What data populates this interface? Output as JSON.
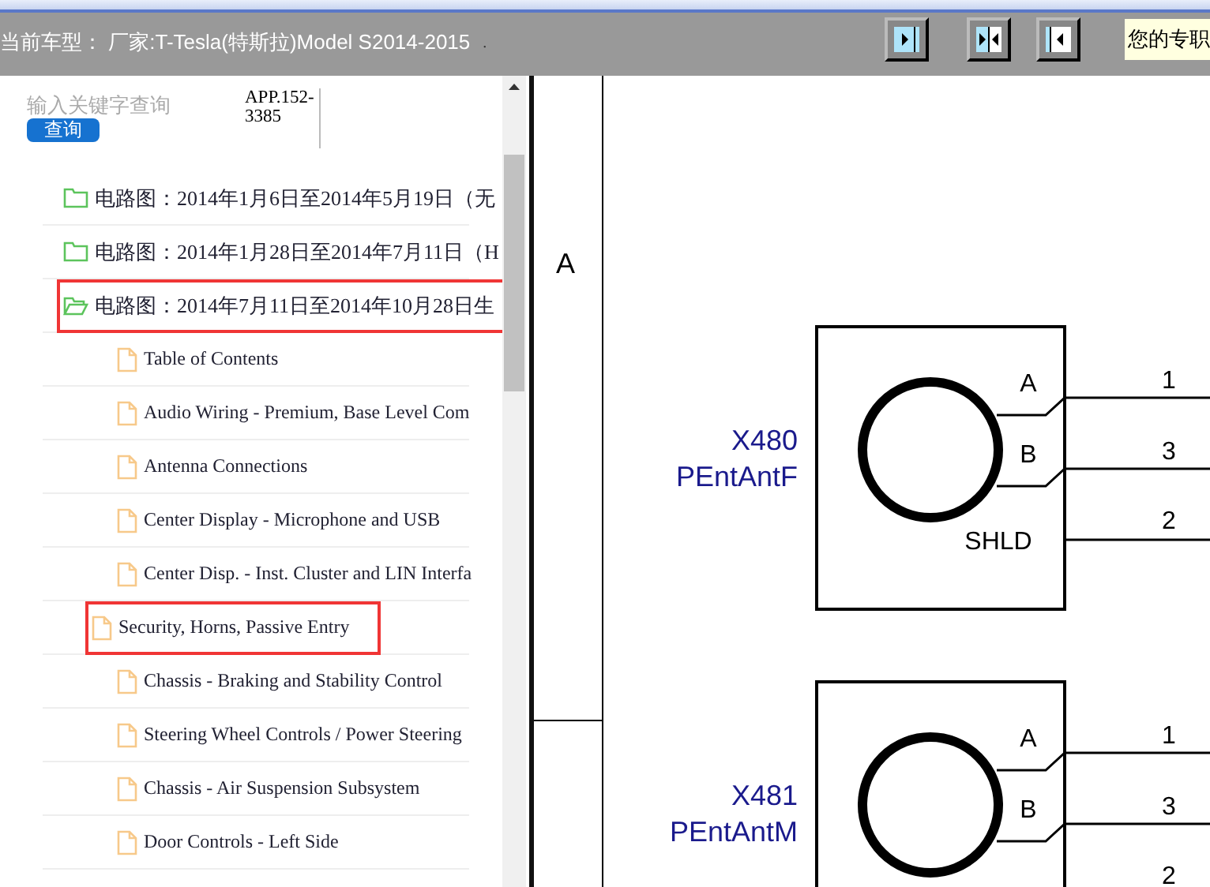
{
  "header": {
    "title": "当前车型： 厂家:T-Tesla(特斯拉)Model S2014-2015",
    "mark": ".",
    "view_buttons": [
      {
        "kind": "right"
      },
      {
        "kind": "both"
      },
      {
        "kind": "left"
      }
    ],
    "notice": "您的专职"
  },
  "search": {
    "placeholder": "输入关键字查询",
    "button": "查询",
    "contact": "APP.152-3385"
  },
  "tree": [
    {
      "label": "电路图：2014年1月6日至2014年5月19日（无",
      "kind": "folder",
      "expanded": false,
      "highlighted": false
    },
    {
      "label": "电路图：2014年1月28日至2014年7月11日（H",
      "kind": "folder",
      "expanded": false,
      "highlighted": false
    },
    {
      "label": "电路图：2014年7月11日至2014年10月28日生",
      "kind": "folder",
      "expanded": true,
      "highlighted": true,
      "children": [
        {
          "label": "Table of Contents",
          "highlighted": false
        },
        {
          "label": "Audio Wiring - Premium, Base Level Com",
          "highlighted": false
        },
        {
          "label": "Antenna Connections",
          "highlighted": false
        },
        {
          "label": "Center Display - Microphone and USB",
          "highlighted": false
        },
        {
          "label": "Center Disp. - Inst. Cluster and LIN Interfa",
          "highlighted": false
        },
        {
          "label": "Security, Horns, Passive Entry",
          "highlighted": true
        },
        {
          "label": "Chassis - Braking and Stability Control",
          "highlighted": false
        },
        {
          "label": "Steering Wheel Controls / Power Steering",
          "highlighted": false
        },
        {
          "label": "Chassis - Air Suspension Subsystem",
          "highlighted": false
        },
        {
          "label": "Door Controls - Left Side",
          "highlighted": false
        }
      ]
    }
  ],
  "diagram": {
    "row_label": "A",
    "connectors": [
      {
        "id": "X480",
        "name": "PEntAntF",
        "pins": [
          {
            "label": "A",
            "number": "1"
          },
          {
            "label": "B",
            "number": "3"
          }
        ],
        "shield": {
          "label": "SHLD",
          "number": "2"
        }
      },
      {
        "id": "X481",
        "name": "PEntAntM",
        "pins": [
          {
            "label": "A",
            "number": "1"
          },
          {
            "label": "B",
            "number": "3"
          }
        ],
        "shield": {
          "number": "2"
        }
      }
    ]
  }
}
